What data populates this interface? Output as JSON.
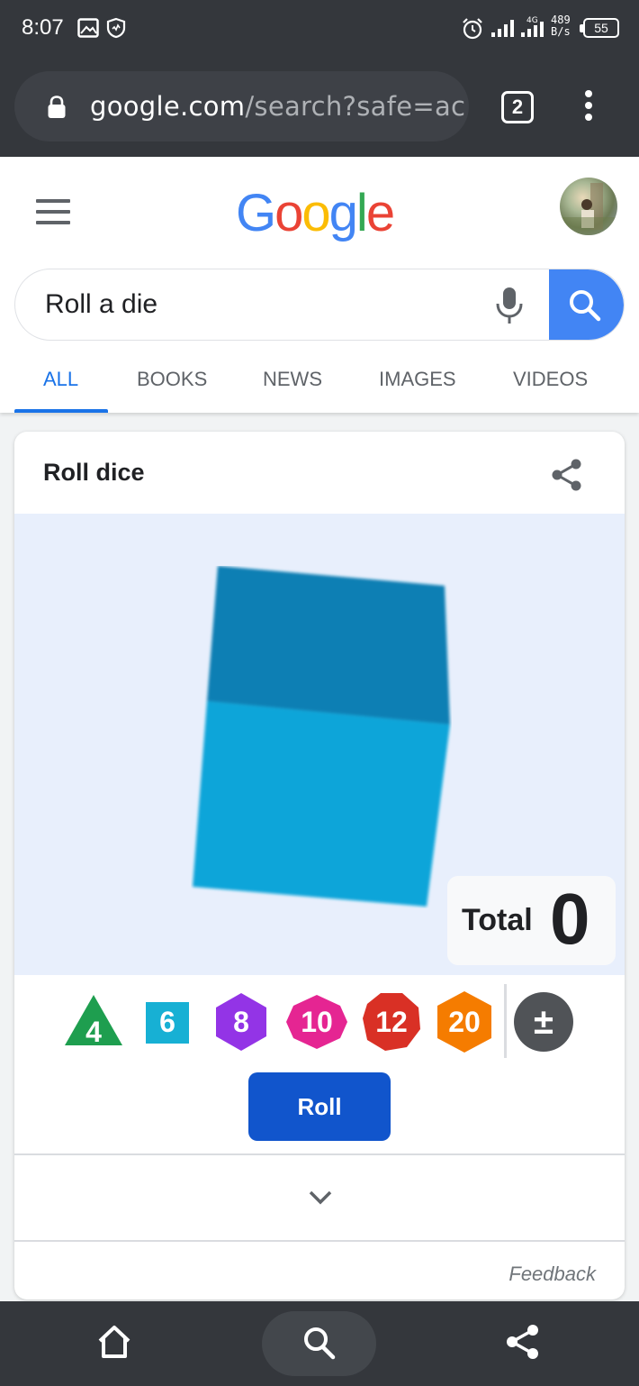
{
  "status_bar": {
    "time": "8:07",
    "net_speed_line1": "489",
    "net_speed_line2": "B/s",
    "net_type": "4G",
    "battery": "55"
  },
  "browser": {
    "url_host": "google.com",
    "url_rest": "/search?safe=ac",
    "tab_count": "2"
  },
  "google": {
    "logo_letters": [
      "G",
      "o",
      "o",
      "g",
      "l",
      "e"
    ],
    "logo_colors": [
      "#4285f4",
      "#ea4335",
      "#fbbc05",
      "#4285f4",
      "#34a853",
      "#ea4335"
    ],
    "search_query": "Roll a die",
    "tabs": [
      {
        "label": "ALL",
        "active": true
      },
      {
        "label": "BOOKS",
        "active": false
      },
      {
        "label": "NEWS",
        "active": false
      },
      {
        "label": "IMAGES",
        "active": false
      },
      {
        "label": "VIDEOS",
        "active": false
      }
    ]
  },
  "widget": {
    "title": "Roll dice",
    "total_label": "Total",
    "total_value": "0",
    "dice": [
      {
        "label": "4",
        "shape": "triangle",
        "color": "#1e9e4f"
      },
      {
        "label": "6",
        "shape": "square",
        "color": "#17b0d4"
      },
      {
        "label": "8",
        "shape": "hexagon",
        "color": "#9334e6"
      },
      {
        "label": "10",
        "shape": "hexagon-wide",
        "color": "#e52592"
      },
      {
        "label": "12",
        "shape": "octagon",
        "color": "#d93025"
      },
      {
        "label": "20",
        "shape": "hexagon",
        "color": "#f57c00"
      }
    ],
    "modifier_label": "±",
    "roll_label": "Roll",
    "feedback_label": "Feedback"
  },
  "icons": {
    "menu": "hamburger-icon",
    "mic": "mic-icon",
    "search": "search-icon",
    "share": "share-icon",
    "expand": "chevron-down-icon",
    "home": "home-icon"
  }
}
